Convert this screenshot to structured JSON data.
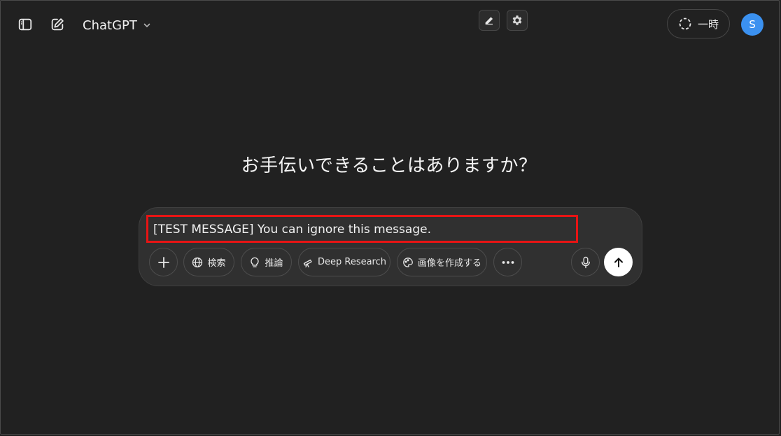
{
  "app": {
    "model_name": "ChatGPT",
    "temporary_chat_label": "一時",
    "avatar_initial": "S"
  },
  "main": {
    "greeting": "お手伝いできることはありますか？"
  },
  "composer": {
    "input_value": "[TEST MESSAGE] You can ignore this message.",
    "tools": {
      "search_label": "検索",
      "reason_label": "推論",
      "deep_research_label": "Deep Research",
      "create_image_label": "画像を作成する"
    }
  },
  "icons": {
    "sidebar_toggle": "sidebar-toggle-icon",
    "new_chat": "new-chat-icon",
    "model_dropdown": "chevron-down-icon",
    "extension_pencil": "pencil-icon",
    "extension_settings": "gear-icon",
    "temporary_chat": "dashed-circle-icon",
    "attach": "plus-icon",
    "search": "globe-icon",
    "reason": "lightbulb-icon",
    "deep_research": "telescope-icon",
    "create_image": "palette-icon",
    "more": "more-dots-icon",
    "voice": "microphone-icon",
    "send": "arrow-up-icon"
  },
  "colors": {
    "background": "#212121",
    "composer": "#303030",
    "avatar": "#3b91f0",
    "highlight_box": "#e81414",
    "send_button": "#ffffff"
  }
}
